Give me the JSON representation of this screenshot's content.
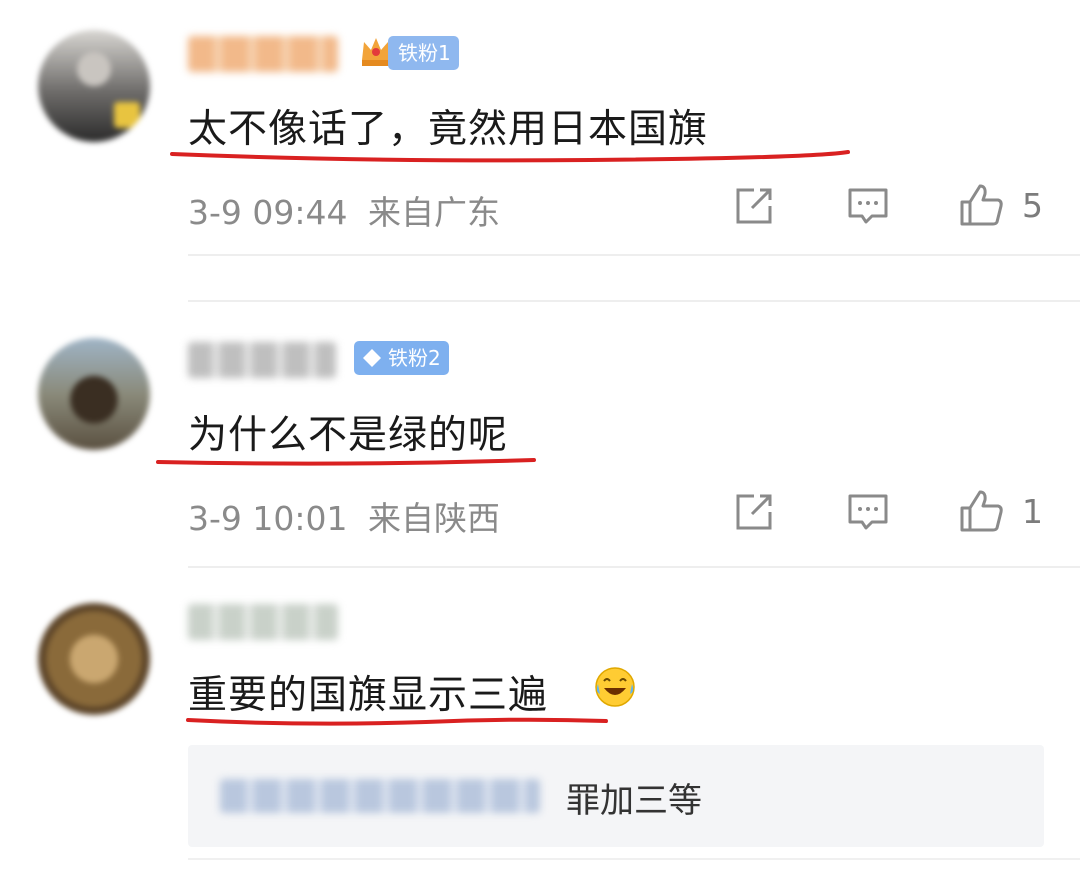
{
  "comments": [
    {
      "badge": "铁粉1",
      "text": "太不像话了，竟然用日本国旗",
      "time": "3-9 09:44",
      "location": "来自广东",
      "likes": "5"
    },
    {
      "badge": "铁粉2",
      "text": "为什么不是绿的呢",
      "time": "3-9 10:01",
      "location": "来自陕西",
      "likes": "1"
    },
    {
      "text": "重要的国旗显示三遍",
      "emoji": "laugh-cry-emoji",
      "reply": {
        "text": "罪加三等"
      }
    }
  ],
  "icons": [
    "share-icon",
    "comment-icon",
    "like-icon",
    "crown-icon",
    "diamond-icon"
  ],
  "colors": {
    "underline": "#d92121",
    "badge": "#8fb8ef",
    "meta": "#8a8a8a"
  }
}
